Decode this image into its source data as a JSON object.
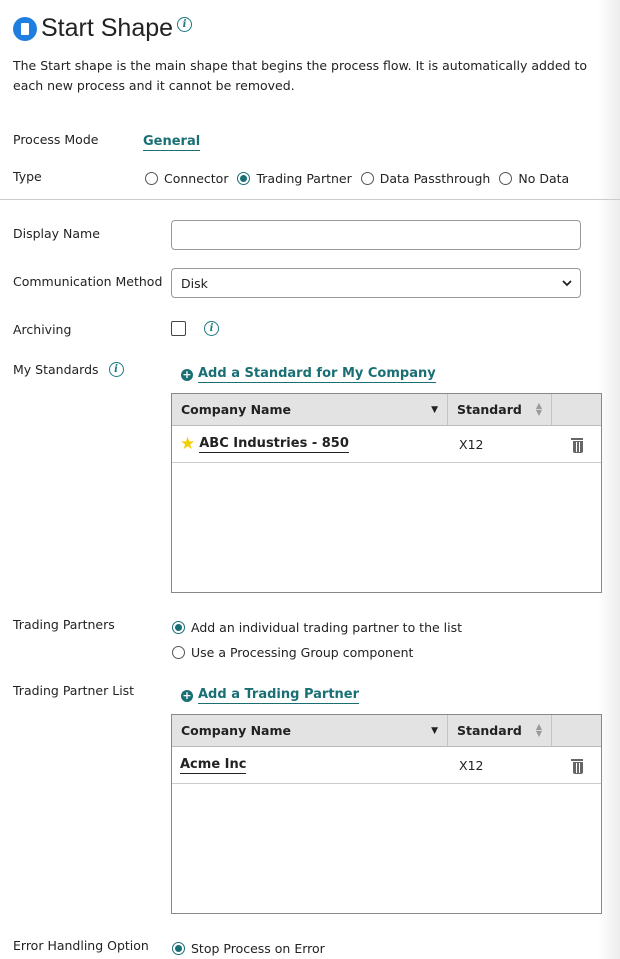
{
  "header": {
    "title": "Start Shape",
    "description": "The Start shape is the main shape that begins the process flow. It is automatically added to each new process and it cannot be removed."
  },
  "process_mode": {
    "label": "Process Mode",
    "value": "General"
  },
  "type": {
    "label": "Type",
    "options": [
      "Connector",
      "Trading Partner",
      "Data Passthrough",
      "No Data"
    ],
    "selected": "Trading Partner"
  },
  "display_name": {
    "label": "Display Name",
    "value": ""
  },
  "communication_method": {
    "label": "Communication Method",
    "value": "Disk"
  },
  "archiving": {
    "label": "Archiving",
    "checked": false
  },
  "my_standards": {
    "label": "My Standards",
    "add_label": "Add a Standard for My Company",
    "columns": [
      "Company Name",
      "Standard"
    ],
    "rows": [
      {
        "company": "ABC Industries - 850",
        "standard": "X12",
        "starred": true
      }
    ]
  },
  "trading_partners": {
    "label": "Trading Partners",
    "options": [
      "Add an individual trading partner to the list",
      "Use a Processing Group component"
    ],
    "selected": "Add an individual trading partner to the list"
  },
  "trading_partner_list": {
    "label": "Trading Partner List",
    "add_label": "Add a Trading Partner",
    "columns": [
      "Company Name",
      "Standard"
    ],
    "rows": [
      {
        "company": "Acme Inc",
        "standard": "X12"
      }
    ]
  },
  "error_handling": {
    "label": "Error Handling Option",
    "option": "Stop Process on Error"
  },
  "colors": {
    "accent": "#1a6f75",
    "title_icon": "#1f7fe0",
    "star": "#f2d000"
  }
}
